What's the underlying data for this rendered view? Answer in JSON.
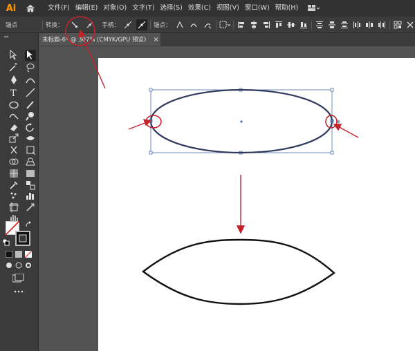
{
  "app": {
    "logo": "Ai"
  },
  "menu": [
    "文件(F)",
    "编辑(E)",
    "对象(O)",
    "文字(T)",
    "选择(S)",
    "效果(C)",
    "视图(V)",
    "窗口(W)",
    "帮助(H)"
  ],
  "control_bar": {
    "context_label": "锚点",
    "convert_label": "转换：",
    "handles_label": "手柄：",
    "anchors_label": "锚点："
  },
  "document": {
    "tab_title": "未标题-6* @ 307% (CMYK/GPU 预览)",
    "close_glyph": "×"
  },
  "colors": {
    "accent_ai": "#ff9a00",
    "annotation_red": "#c4222a",
    "selection_blue": "#4a6fa5",
    "ellipse_stroke": "#2f3a5e"
  }
}
